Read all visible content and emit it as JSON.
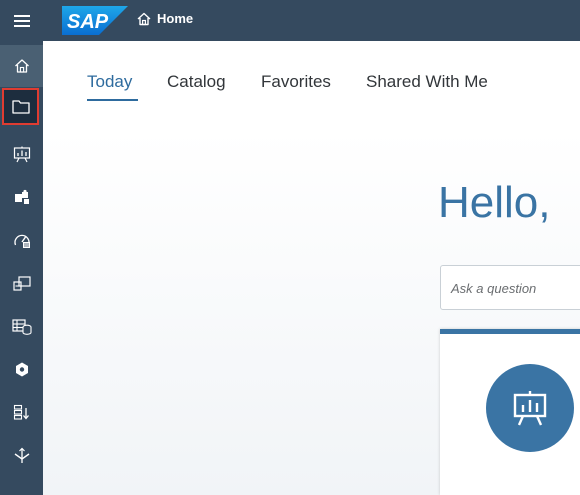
{
  "shell": {
    "home_label": "Home",
    "accent": "#354a5f"
  },
  "logo": {
    "text": "SAP"
  },
  "sidebar": {
    "items": [
      {
        "icon": "home-icon"
      },
      {
        "icon": "folder-icon",
        "highlighted": true
      },
      {
        "icon": "presentation-icon"
      },
      {
        "icon": "puzzle-icon"
      },
      {
        "icon": "gauge-icon"
      },
      {
        "icon": "data-link-icon"
      },
      {
        "icon": "database-table-icon"
      },
      {
        "icon": "cube-network-icon"
      },
      {
        "icon": "list-sort-icon"
      },
      {
        "icon": "transport-icon"
      }
    ]
  },
  "tabs": [
    {
      "label": "Today"
    },
    {
      "label": "Catalog"
    },
    {
      "label": "Favorites"
    },
    {
      "label": "Shared With Me"
    }
  ],
  "greeting": "Hello,",
  "search": {
    "placeholder": "Ask a question"
  },
  "card": {
    "icon": "presentation-icon"
  }
}
